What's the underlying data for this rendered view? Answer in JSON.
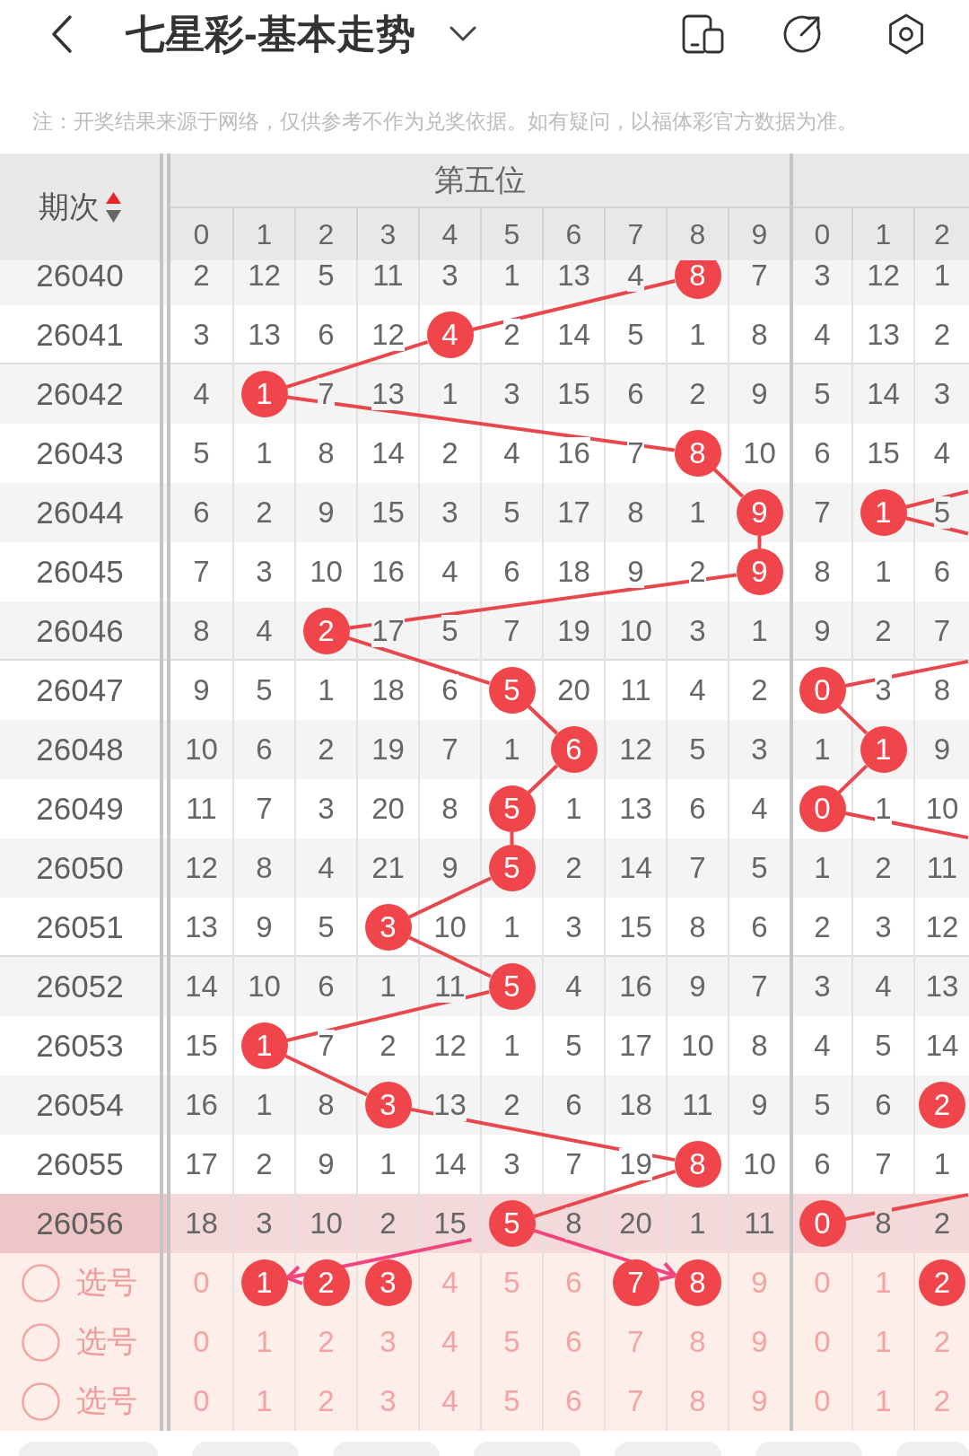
{
  "header": {
    "title": "七星彩-基本走势"
  },
  "notice": "注：开奖结果来源于网络，仅供参考不作为兑奖依据。如有疑问，以福体彩官方数据为准。",
  "table": {
    "period_heading": "期次",
    "sorted_ascending": true,
    "groups": [
      {
        "title": "第五位",
        "digits": [
          "0",
          "1",
          "2",
          "3",
          "4",
          "5",
          "6",
          "7",
          "8",
          "9"
        ]
      },
      {
        "digits": [
          "0",
          "1",
          "2"
        ]
      }
    ],
    "rows": [
      {
        "period": "26040",
        "highlighted": false,
        "groups": [
          [
            {
              "value": "2",
              "hit": false
            },
            {
              "value": "12",
              "hit": false
            },
            {
              "value": "5",
              "hit": false
            },
            {
              "value": "11",
              "hit": false
            },
            {
              "value": "3",
              "hit": false
            },
            {
              "value": "1",
              "hit": false
            },
            {
              "value": "13",
              "hit": false
            },
            {
              "value": "4",
              "hit": false
            },
            {
              "value": "8",
              "hit": true
            },
            {
              "value": "7",
              "hit": false
            }
          ],
          [
            {
              "value": "3",
              "hit": false
            },
            {
              "value": "12",
              "hit": false
            },
            {
              "value": "1",
              "hit": false
            }
          ]
        ]
      },
      {
        "period": "26041",
        "highlighted": false,
        "groups": [
          [
            {
              "value": "3",
              "hit": false
            },
            {
              "value": "13",
              "hit": false
            },
            {
              "value": "6",
              "hit": false
            },
            {
              "value": "12",
              "hit": false
            },
            {
              "value": "4",
              "hit": true
            },
            {
              "value": "2",
              "hit": false
            },
            {
              "value": "14",
              "hit": false
            },
            {
              "value": "5",
              "hit": false
            },
            {
              "value": "1",
              "hit": false
            },
            {
              "value": "8",
              "hit": false
            }
          ],
          [
            {
              "value": "4",
              "hit": false
            },
            {
              "value": "13",
              "hit": false
            },
            {
              "value": "2",
              "hit": false
            }
          ]
        ]
      },
      {
        "period": "26042",
        "highlighted": false,
        "groups": [
          [
            {
              "value": "4",
              "hit": false
            },
            {
              "value": "1",
              "hit": true
            },
            {
              "value": "7",
              "hit": false
            },
            {
              "value": "13",
              "hit": false
            },
            {
              "value": "1",
              "hit": false
            },
            {
              "value": "3",
              "hit": false
            },
            {
              "value": "15",
              "hit": false
            },
            {
              "value": "6",
              "hit": false
            },
            {
              "value": "2",
              "hit": false
            },
            {
              "value": "9",
              "hit": false
            }
          ],
          [
            {
              "value": "5",
              "hit": false
            },
            {
              "value": "14",
              "hit": false
            },
            {
              "value": "3",
              "hit": false
            }
          ]
        ]
      },
      {
        "period": "26043",
        "highlighted": false,
        "groups": [
          [
            {
              "value": "5",
              "hit": false
            },
            {
              "value": "1",
              "hit": false
            },
            {
              "value": "8",
              "hit": false
            },
            {
              "value": "14",
              "hit": false
            },
            {
              "value": "2",
              "hit": false
            },
            {
              "value": "4",
              "hit": false
            },
            {
              "value": "16",
              "hit": false
            },
            {
              "value": "7",
              "hit": false
            },
            {
              "value": "8",
              "hit": true
            },
            {
              "value": "10",
              "hit": false
            }
          ],
          [
            {
              "value": "6",
              "hit": false
            },
            {
              "value": "15",
              "hit": false
            },
            {
              "value": "4",
              "hit": false
            }
          ]
        ]
      },
      {
        "period": "26044",
        "highlighted": false,
        "groups": [
          [
            {
              "value": "6",
              "hit": false
            },
            {
              "value": "2",
              "hit": false
            },
            {
              "value": "9",
              "hit": false
            },
            {
              "value": "15",
              "hit": false
            },
            {
              "value": "3",
              "hit": false
            },
            {
              "value": "5",
              "hit": false
            },
            {
              "value": "17",
              "hit": false
            },
            {
              "value": "8",
              "hit": false
            },
            {
              "value": "1",
              "hit": false
            },
            {
              "value": "9",
              "hit": true
            }
          ],
          [
            {
              "value": "7",
              "hit": false
            },
            {
              "value": "1",
              "hit": true
            },
            {
              "value": "5",
              "hit": false
            }
          ]
        ]
      },
      {
        "period": "26045",
        "highlighted": false,
        "groups": [
          [
            {
              "value": "7",
              "hit": false
            },
            {
              "value": "3",
              "hit": false
            },
            {
              "value": "10",
              "hit": false
            },
            {
              "value": "16",
              "hit": false
            },
            {
              "value": "4",
              "hit": false
            },
            {
              "value": "6",
              "hit": false
            },
            {
              "value": "18",
              "hit": false
            },
            {
              "value": "9",
              "hit": false
            },
            {
              "value": "2",
              "hit": false
            },
            {
              "value": "9",
              "hit": true
            }
          ],
          [
            {
              "value": "8",
              "hit": false
            },
            {
              "value": "1",
              "hit": false
            },
            {
              "value": "6",
              "hit": false
            }
          ]
        ]
      },
      {
        "period": "26046",
        "highlighted": false,
        "groups": [
          [
            {
              "value": "8",
              "hit": false
            },
            {
              "value": "4",
              "hit": false
            },
            {
              "value": "2",
              "hit": true
            },
            {
              "value": "17",
              "hit": false
            },
            {
              "value": "5",
              "hit": false
            },
            {
              "value": "7",
              "hit": false
            },
            {
              "value": "19",
              "hit": false
            },
            {
              "value": "10",
              "hit": false
            },
            {
              "value": "3",
              "hit": false
            },
            {
              "value": "1",
              "hit": false
            }
          ],
          [
            {
              "value": "9",
              "hit": false
            },
            {
              "value": "2",
              "hit": false
            },
            {
              "value": "7",
              "hit": false
            }
          ]
        ]
      },
      {
        "period": "26047",
        "highlighted": false,
        "groups": [
          [
            {
              "value": "9",
              "hit": false
            },
            {
              "value": "5",
              "hit": false
            },
            {
              "value": "1",
              "hit": false
            },
            {
              "value": "18",
              "hit": false
            },
            {
              "value": "6",
              "hit": false
            },
            {
              "value": "5",
              "hit": true
            },
            {
              "value": "20",
              "hit": false
            },
            {
              "value": "11",
              "hit": false
            },
            {
              "value": "4",
              "hit": false
            },
            {
              "value": "2",
              "hit": false
            }
          ],
          [
            {
              "value": "0",
              "hit": true
            },
            {
              "value": "3",
              "hit": false
            },
            {
              "value": "8",
              "hit": false
            }
          ]
        ]
      },
      {
        "period": "26048",
        "highlighted": false,
        "groups": [
          [
            {
              "value": "10",
              "hit": false
            },
            {
              "value": "6",
              "hit": false
            },
            {
              "value": "2",
              "hit": false
            },
            {
              "value": "19",
              "hit": false
            },
            {
              "value": "7",
              "hit": false
            },
            {
              "value": "1",
              "hit": false
            },
            {
              "value": "6",
              "hit": true
            },
            {
              "value": "12",
              "hit": false
            },
            {
              "value": "5",
              "hit": false
            },
            {
              "value": "3",
              "hit": false
            }
          ],
          [
            {
              "value": "1",
              "hit": false
            },
            {
              "value": "1",
              "hit": true
            },
            {
              "value": "9",
              "hit": false
            }
          ]
        ]
      },
      {
        "period": "26049",
        "highlighted": false,
        "groups": [
          [
            {
              "value": "11",
              "hit": false
            },
            {
              "value": "7",
              "hit": false
            },
            {
              "value": "3",
              "hit": false
            },
            {
              "value": "20",
              "hit": false
            },
            {
              "value": "8",
              "hit": false
            },
            {
              "value": "5",
              "hit": true
            },
            {
              "value": "1",
              "hit": false
            },
            {
              "value": "13",
              "hit": false
            },
            {
              "value": "6",
              "hit": false
            },
            {
              "value": "4",
              "hit": false
            }
          ],
          [
            {
              "value": "0",
              "hit": true
            },
            {
              "value": "1",
              "hit": false
            },
            {
              "value": "10",
              "hit": false
            }
          ]
        ]
      },
      {
        "period": "26050",
        "highlighted": false,
        "groups": [
          [
            {
              "value": "12",
              "hit": false
            },
            {
              "value": "8",
              "hit": false
            },
            {
              "value": "4",
              "hit": false
            },
            {
              "value": "21",
              "hit": false
            },
            {
              "value": "9",
              "hit": false
            },
            {
              "value": "5",
              "hit": true
            },
            {
              "value": "2",
              "hit": false
            },
            {
              "value": "14",
              "hit": false
            },
            {
              "value": "7",
              "hit": false
            },
            {
              "value": "5",
              "hit": false
            }
          ],
          [
            {
              "value": "1",
              "hit": false
            },
            {
              "value": "2",
              "hit": false
            },
            {
              "value": "11",
              "hit": false
            }
          ]
        ]
      },
      {
        "period": "26051",
        "highlighted": false,
        "groups": [
          [
            {
              "value": "13",
              "hit": false
            },
            {
              "value": "9",
              "hit": false
            },
            {
              "value": "5",
              "hit": false
            },
            {
              "value": "3",
              "hit": true
            },
            {
              "value": "10",
              "hit": false
            },
            {
              "value": "1",
              "hit": false
            },
            {
              "value": "3",
              "hit": false
            },
            {
              "value": "15",
              "hit": false
            },
            {
              "value": "8",
              "hit": false
            },
            {
              "value": "6",
              "hit": false
            }
          ],
          [
            {
              "value": "2",
              "hit": false
            },
            {
              "value": "3",
              "hit": false
            },
            {
              "value": "12",
              "hit": false
            }
          ]
        ]
      },
      {
        "period": "26052",
        "highlighted": false,
        "groups": [
          [
            {
              "value": "14",
              "hit": false
            },
            {
              "value": "10",
              "hit": false
            },
            {
              "value": "6",
              "hit": false
            },
            {
              "value": "1",
              "hit": false
            },
            {
              "value": "11",
              "hit": false
            },
            {
              "value": "5",
              "hit": true
            },
            {
              "value": "4",
              "hit": false
            },
            {
              "value": "16",
              "hit": false
            },
            {
              "value": "9",
              "hit": false
            },
            {
              "value": "7",
              "hit": false
            }
          ],
          [
            {
              "value": "3",
              "hit": false
            },
            {
              "value": "4",
              "hit": false
            },
            {
              "value": "13",
              "hit": false
            }
          ]
        ]
      },
      {
        "period": "26053",
        "highlighted": false,
        "groups": [
          [
            {
              "value": "15",
              "hit": false
            },
            {
              "value": "1",
              "hit": true
            },
            {
              "value": "7",
              "hit": false
            },
            {
              "value": "2",
              "hit": false
            },
            {
              "value": "12",
              "hit": false
            },
            {
              "value": "1",
              "hit": false
            },
            {
              "value": "5",
              "hit": false
            },
            {
              "value": "17",
              "hit": false
            },
            {
              "value": "10",
              "hit": false
            },
            {
              "value": "8",
              "hit": false
            }
          ],
          [
            {
              "value": "4",
              "hit": false
            },
            {
              "value": "5",
              "hit": false
            },
            {
              "value": "14",
              "hit": false
            }
          ]
        ]
      },
      {
        "period": "26054",
        "highlighted": false,
        "groups": [
          [
            {
              "value": "16",
              "hit": false
            },
            {
              "value": "1",
              "hit": false
            },
            {
              "value": "8",
              "hit": false
            },
            {
              "value": "3",
              "hit": true
            },
            {
              "value": "13",
              "hit": false
            },
            {
              "value": "2",
              "hit": false
            },
            {
              "value": "6",
              "hit": false
            },
            {
              "value": "18",
              "hit": false
            },
            {
              "value": "11",
              "hit": false
            },
            {
              "value": "9",
              "hit": false
            }
          ],
          [
            {
              "value": "5",
              "hit": false
            },
            {
              "value": "6",
              "hit": false
            },
            {
              "value": "2",
              "hit": true
            }
          ]
        ]
      },
      {
        "period": "26055",
        "highlighted": false,
        "groups": [
          [
            {
              "value": "17",
              "hit": false
            },
            {
              "value": "2",
              "hit": false
            },
            {
              "value": "9",
              "hit": false
            },
            {
              "value": "1",
              "hit": false
            },
            {
              "value": "14",
              "hit": false
            },
            {
              "value": "3",
              "hit": false
            },
            {
              "value": "7",
              "hit": false
            },
            {
              "value": "19",
              "hit": false
            },
            {
              "value": "8",
              "hit": true
            },
            {
              "value": "10",
              "hit": false
            }
          ],
          [
            {
              "value": "6",
              "hit": false
            },
            {
              "value": "7",
              "hit": false
            },
            {
              "value": "1",
              "hit": false
            }
          ]
        ]
      },
      {
        "period": "26056",
        "highlighted": true,
        "groups": [
          [
            {
              "value": "18",
              "hit": false
            },
            {
              "value": "3",
              "hit": false
            },
            {
              "value": "10",
              "hit": false
            },
            {
              "value": "2",
              "hit": false
            },
            {
              "value": "15",
              "hit": false
            },
            {
              "value": "5",
              "hit": true
            },
            {
              "value": "8",
              "hit": false
            },
            {
              "value": "20",
              "hit": false
            },
            {
              "value": "1",
              "hit": false
            },
            {
              "value": "11",
              "hit": false
            }
          ],
          [
            {
              "value": "0",
              "hit": true
            },
            {
              "value": "8",
              "hit": false
            },
            {
              "value": "2",
              "hit": false
            }
          ]
        ]
      }
    ],
    "pick_rows": [
      {
        "label": "选号",
        "checked": false,
        "groups": [
          [
            {
              "value": "0",
              "selected": false
            },
            {
              "value": "1",
              "selected": true
            },
            {
              "value": "2",
              "selected": true
            },
            {
              "value": "3",
              "selected": true
            },
            {
              "value": "4",
              "selected": false
            },
            {
              "value": "5",
              "selected": false
            },
            {
              "value": "6",
              "selected": false
            },
            {
              "value": "7",
              "selected": true
            },
            {
              "value": "8",
              "selected": true
            },
            {
              "value": "9",
              "selected": false
            }
          ],
          [
            {
              "value": "0",
              "selected": false
            },
            {
              "value": "1",
              "selected": false
            },
            {
              "value": "2",
              "selected": true
            }
          ]
        ]
      },
      {
        "label": "选号",
        "checked": false,
        "groups": [
          [
            {
              "value": "0",
              "selected": false
            },
            {
              "value": "1",
              "selected": false
            },
            {
              "value": "2",
              "selected": false
            },
            {
              "value": "3",
              "selected": false
            },
            {
              "value": "4",
              "selected": false
            },
            {
              "value": "5",
              "selected": false
            },
            {
              "value": "6",
              "selected": false
            },
            {
              "value": "7",
              "selected": false
            },
            {
              "value": "8",
              "selected": false
            },
            {
              "value": "9",
              "selected": false
            }
          ],
          [
            {
              "value": "0",
              "selected": false
            },
            {
              "value": "1",
              "selected": false
            },
            {
              "value": "2",
              "selected": false
            }
          ]
        ]
      },
      {
        "label": "选号",
        "checked": false,
        "groups": [
          [
            {
              "value": "0",
              "selected": false
            },
            {
              "value": "1",
              "selected": false
            },
            {
              "value": "2",
              "selected": false
            },
            {
              "value": "3",
              "selected": false
            },
            {
              "value": "4",
              "selected": false
            },
            {
              "value": "5",
              "selected": false
            },
            {
              "value": "6",
              "selected": false
            },
            {
              "value": "7",
              "selected": false
            },
            {
              "value": "8",
              "selected": false
            },
            {
              "value": "9",
              "selected": false
            }
          ],
          [
            {
              "value": "0",
              "selected": false
            },
            {
              "value": "1",
              "selected": false
            },
            {
              "value": "2",
              "selected": false
            }
          ]
        ]
      }
    ]
  }
}
